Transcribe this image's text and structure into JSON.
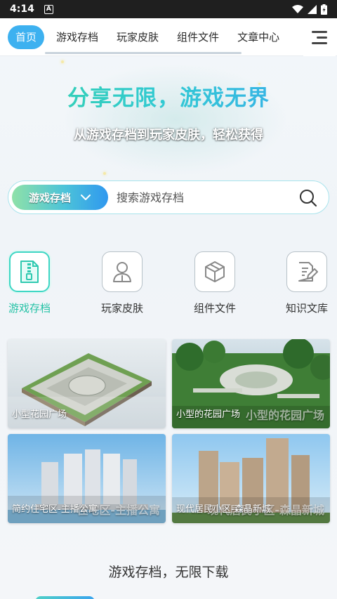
{
  "status_bar": {
    "time": "4:14",
    "notification_icon": "A"
  },
  "nav": {
    "tabs": [
      {
        "label": "首页",
        "active": true
      },
      {
        "label": "游戏存档",
        "active": false
      },
      {
        "label": "玩家皮肤",
        "active": false
      },
      {
        "label": "组件文件",
        "active": false
      },
      {
        "label": "文章中心",
        "active": false
      }
    ],
    "menu_icon": "menu-icon"
  },
  "hero": {
    "title": "分享无限，游戏无界",
    "subtitle": "从游戏存档到玩家皮肤，轻松获得"
  },
  "search": {
    "type_label": "游戏存档",
    "placeholder": "搜索游戏存档"
  },
  "categories": [
    {
      "label": "游戏存档",
      "icon": "archive-zip-icon",
      "active": true
    },
    {
      "label": "玩家皮肤",
      "icon": "player-icon",
      "active": false
    },
    {
      "label": "组件文件",
      "icon": "cube-icon",
      "active": false
    },
    {
      "label": "知识文库",
      "icon": "document-edit-icon",
      "active": false
    }
  ],
  "cards": [
    {
      "caption": "小型花园广场",
      "overlay": ""
    },
    {
      "caption": "小型的花园广场",
      "overlay": "小型的花园广场"
    },
    {
      "caption": "简约住宅区-主播公寓",
      "overlay": "住宅区-主播公寓"
    },
    {
      "caption": "现代居民小区-森晶新城",
      "overlay": "现代居民小区-森晶新城"
    }
  ],
  "section": {
    "title": "游戏存档，无限下载"
  },
  "colors": {
    "accent": "#3db1f0",
    "teal": "#26c2a6"
  }
}
